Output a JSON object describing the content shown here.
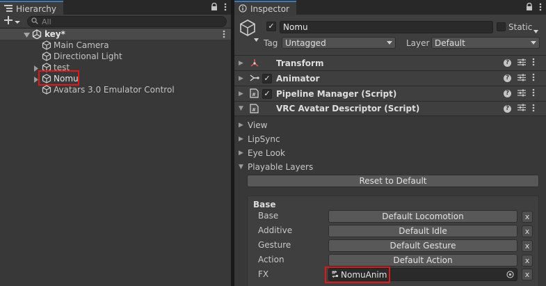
{
  "hierarchy": {
    "tab_title": "Hierarchy",
    "search_placeholder": "All",
    "scene": {
      "name": "key*"
    },
    "items": [
      {
        "label": "Main Camera"
      },
      {
        "label": "Directional Light"
      },
      {
        "label": "test"
      },
      {
        "label": "Nomu"
      },
      {
        "label": "Avatars 3.0 Emulator Control"
      }
    ]
  },
  "inspector": {
    "tab_title": "Inspector",
    "object": {
      "name": "Nomu",
      "active": true,
      "static_label": "Static",
      "tag_label": "Tag",
      "tag_value": "Untagged",
      "layer_label": "Layer",
      "layer_value": "Default"
    },
    "components": [
      {
        "name": "Transform",
        "has_checkbox": false
      },
      {
        "name": "Animator",
        "has_checkbox": true
      },
      {
        "name": "Pipeline Manager (Script)",
        "has_checkbox": true
      },
      {
        "name": "VRC Avatar Descriptor (Script)",
        "has_checkbox": false
      }
    ],
    "descriptor": {
      "foldouts": [
        "View",
        "LipSync",
        "Eye Look",
        "Playable Layers"
      ],
      "reset_button": "Reset to Default",
      "base_header": "Base",
      "layers": [
        {
          "label": "Base",
          "value": "Default Locomotion"
        },
        {
          "label": "Additive",
          "value": "Default Idle"
        },
        {
          "label": "Gesture",
          "value": "Default Gesture"
        },
        {
          "label": "Action",
          "value": "Default Action"
        },
        {
          "label": "FX",
          "value": "NomuAnim"
        }
      ],
      "clear_label": "x"
    }
  },
  "colors": {
    "background": "#383838",
    "header_bar": "#3f3f3f",
    "button": "#585858",
    "highlight_box": "#e01818",
    "tab_accent": "#3a79bb"
  }
}
